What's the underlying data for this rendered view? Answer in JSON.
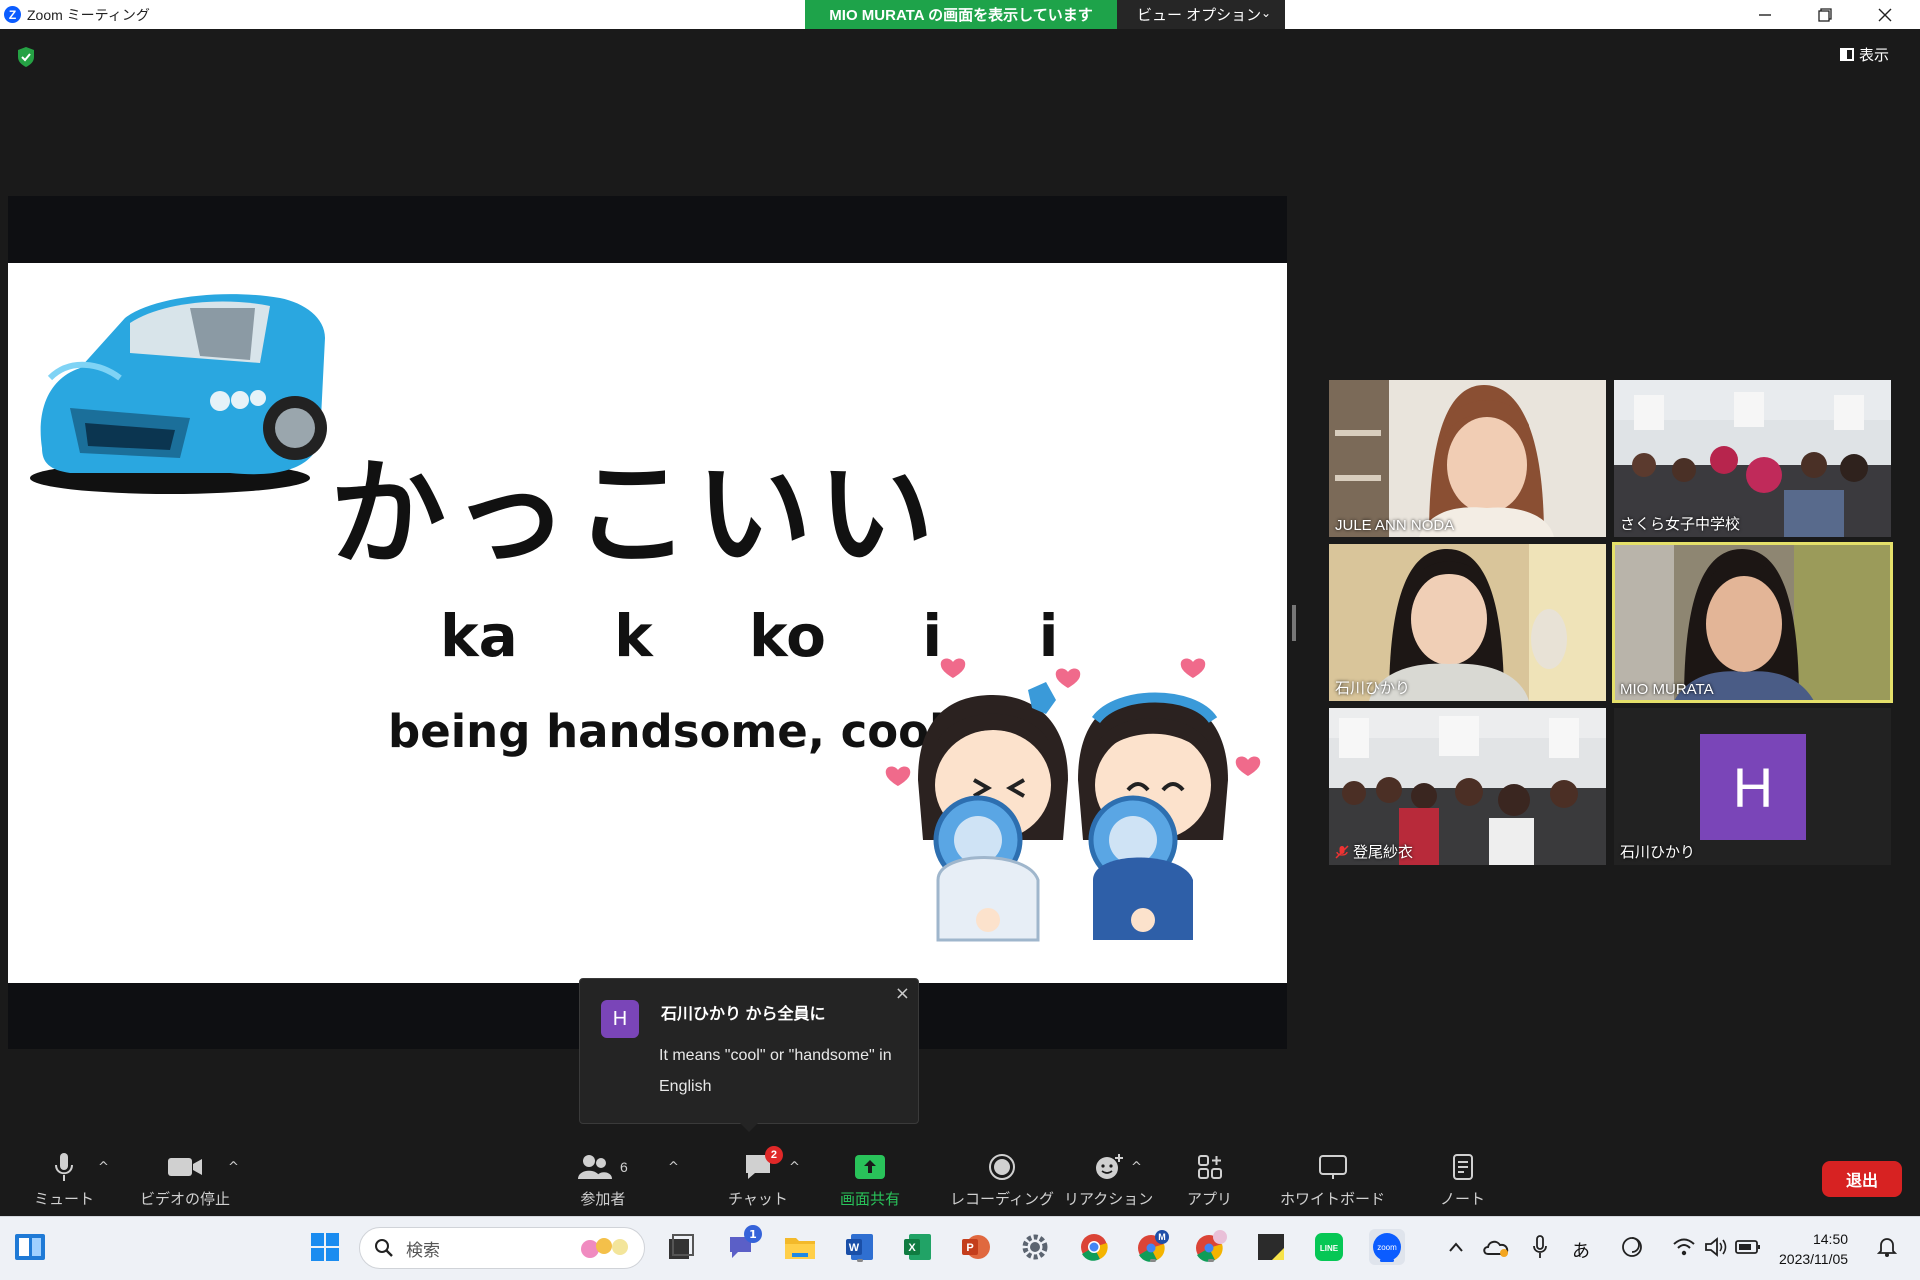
{
  "window": {
    "title": "Zoom ミーティング"
  },
  "banner": {
    "sharing_text": "MIO  MURATA の画面を表示しています",
    "view_options": "ビュー オプション"
  },
  "top": {
    "display_label": "表示"
  },
  "slide": {
    "word": "かっこいい",
    "romaji": "ka  k  ko  i  i",
    "meaning": "being handsome, cool"
  },
  "gallery": [
    {
      "name": "JULE ANN NODA"
    },
    {
      "name": "さくら女子中学校"
    },
    {
      "name": "石川ひかり"
    },
    {
      "name": "MIO MURATA"
    },
    {
      "name": "登尾紗衣"
    },
    {
      "name": "石川ひかり",
      "avatar_letter": "H"
    }
  ],
  "chat_popup": {
    "avatar_letter": "H",
    "from": "石川ひかり から全員に",
    "message": "It means \"cool\" or \"handsome\" in English"
  },
  "toolbar": {
    "mute": "ミュート",
    "video": "ビデオの停止",
    "participants": "参加者",
    "participants_count": "6",
    "chat": "チャット",
    "chat_badge": "2",
    "share": "画面共有",
    "record": "レコーディング",
    "reactions": "リアクション",
    "apps": "アプリ",
    "whiteboard": "ホワイトボード",
    "notes": "ノート",
    "leave": "退出"
  },
  "taskbar": {
    "search_placeholder": "検索",
    "teams_badge": "1",
    "ime": "あ",
    "time": "14:50",
    "date": "2023/11/05"
  },
  "colors": {
    "share_green": "#1ea34a",
    "leave_red": "#d72222",
    "avatar_purple": "#7a45b8",
    "active_speaker": "#e5e06a"
  }
}
